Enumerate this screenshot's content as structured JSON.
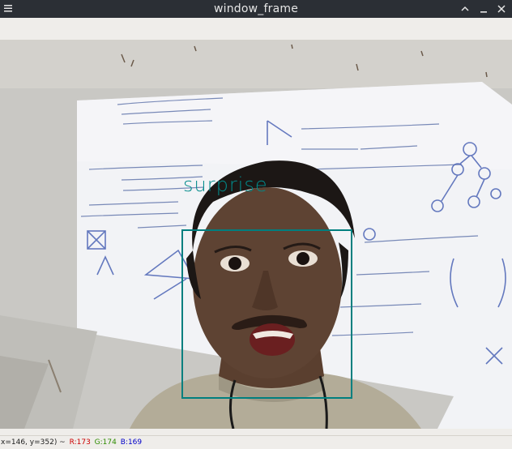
{
  "window": {
    "title": "window_frame"
  },
  "detection": {
    "label": "surprise",
    "box_color": "#008b8b"
  },
  "status": {
    "coords": "x=146, y=352) ~",
    "r_label": "R:173",
    "g_label": "G:174",
    "b_label": "B:169",
    "r_color": "#cc0000",
    "g_color": "#2e8b00",
    "b_color": "#0000c8"
  },
  "icons": {
    "menu": "menu-icon",
    "scroll_up": "chevron-up-icon",
    "minimize": "minimize-icon",
    "close": "close-icon"
  }
}
